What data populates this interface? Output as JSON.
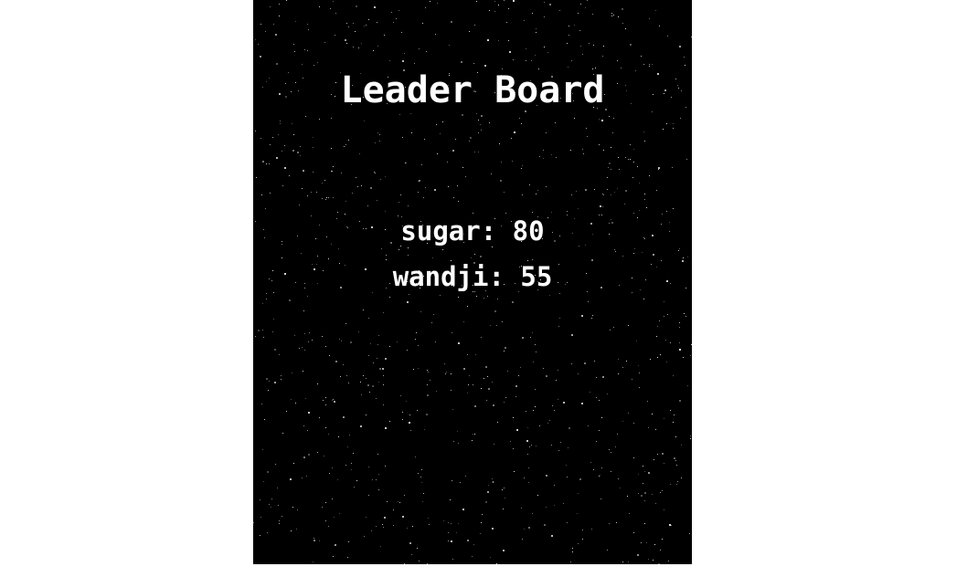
{
  "leaderboard": {
    "title": "Leader Board",
    "entries": [
      {
        "text": "sugar: 80",
        "name": "sugar",
        "score": 80
      },
      {
        "text": "wandji: 55",
        "name": "wandji",
        "score": 55
      }
    ]
  },
  "colors": {
    "page_background": "#ffffff",
    "panel_background": "#000000",
    "text": "#ffffff",
    "star": "#ffffff"
  }
}
